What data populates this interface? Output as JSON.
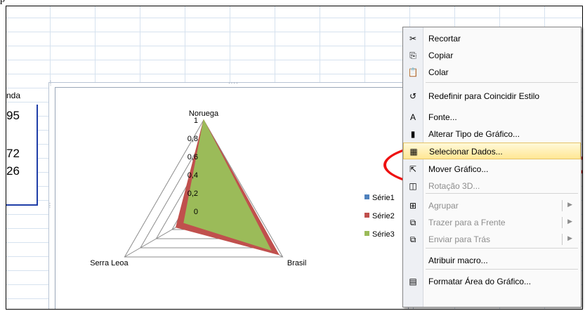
{
  "top_label": "p",
  "sheet": {
    "column_header": "nda",
    "cells": [
      "95",
      "72",
      "26"
    ]
  },
  "chart_data": {
    "type": "radar",
    "categories": [
      "Noruega",
      "Brasil",
      "Serra Leoa"
    ],
    "axis_ticks": [
      "0",
      "0,2",
      "0,4",
      "0,6",
      "0,8",
      "1"
    ],
    "ylim": [
      0,
      1
    ],
    "series": [
      {
        "name": "Série1",
        "color": "#4f81bd",
        "values": [
          1,
          0.9,
          0.3
        ]
      },
      {
        "name": "Série2",
        "color": "#c0504d",
        "values": [
          1,
          0.95,
          0.35
        ]
      },
      {
        "name": "Série3",
        "color": "#9bbb59",
        "values": [
          1,
          0.85,
          0.25
        ]
      }
    ],
    "legend_position": "right"
  },
  "context_menu": {
    "items": [
      {
        "label": "Recortar",
        "icon": "scissors-icon",
        "glyph": "✂",
        "enabled": true
      },
      {
        "label": "Copiar",
        "icon": "copy-icon",
        "glyph": "⎘",
        "enabled": true
      },
      {
        "label": "Colar",
        "icon": "paste-icon",
        "glyph": "📋",
        "enabled": true
      },
      {
        "label": "Redefinir para Coincidir Estilo",
        "icon": "reset-style-icon",
        "glyph": "↺",
        "enabled": true
      },
      {
        "label": "Fonte...",
        "icon": "font-icon",
        "glyph": "A",
        "enabled": true
      },
      {
        "label": "Alterar Tipo de Gráfico...",
        "icon": "chart-type-icon",
        "glyph": "▮",
        "enabled": true
      },
      {
        "label": "Selecionar Dados...",
        "icon": "select-data-icon",
        "glyph": "▦",
        "enabled": true,
        "highlighted": true
      },
      {
        "label": "Mover Gráfico...",
        "icon": "move-chart-icon",
        "glyph": "⇱",
        "enabled": true
      },
      {
        "label": "Rotação 3D...",
        "icon": "rotate-3d-icon",
        "glyph": "◫",
        "enabled": false
      },
      {
        "label": "Agrupar",
        "icon": "group-icon",
        "glyph": "⊞",
        "enabled": false,
        "submenu": true
      },
      {
        "label": "Trazer para a Frente",
        "icon": "bring-front-icon",
        "glyph": "⧉",
        "enabled": false,
        "submenu": true
      },
      {
        "label": "Enviar para Trás",
        "icon": "send-back-icon",
        "glyph": "⧉",
        "enabled": false,
        "submenu": true
      },
      {
        "label": "Atribuir macro...",
        "icon": "",
        "glyph": "",
        "enabled": true
      },
      {
        "label": "Formatar Área do Gráfico...",
        "icon": "format-area-icon",
        "glyph": "▤",
        "enabled": true
      }
    ]
  },
  "colors": {
    "highlight_oval": "#ee1111",
    "selection_border": "#1f3ea8"
  }
}
